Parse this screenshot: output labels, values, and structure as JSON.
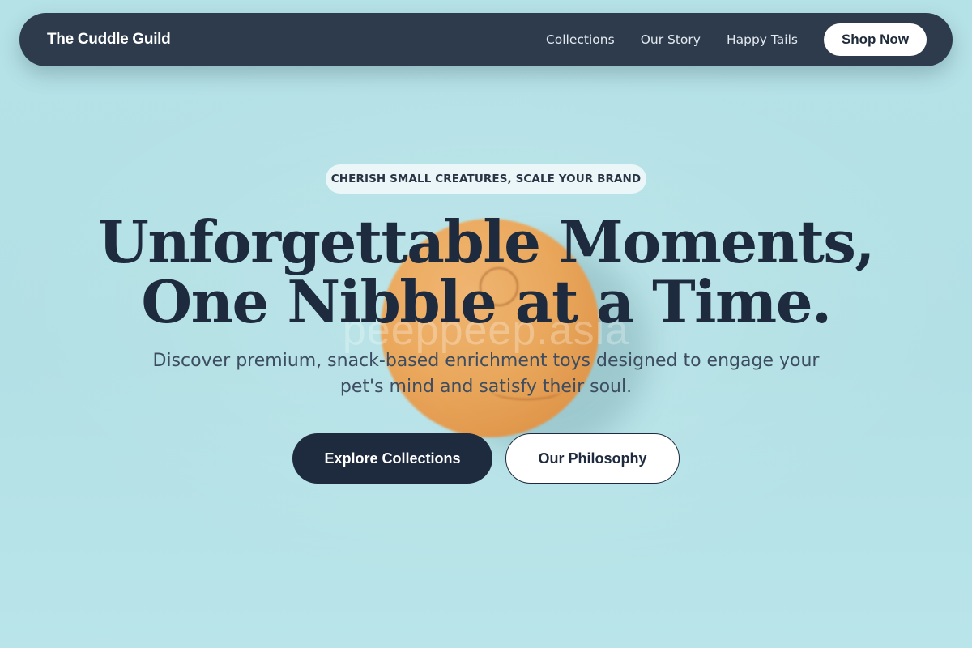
{
  "nav": {
    "brand": "The Cuddle Guild",
    "links": [
      "Collections",
      "Our Story",
      "Happy Tails"
    ],
    "cta": "Shop Now"
  },
  "hero": {
    "tagline": "CHERISH SMALL CREATURES, SCALE YOUR BRAND",
    "headline_line1": "Unforgettable Moments,",
    "headline_line2": "One Nibble at a Time.",
    "subtext_line1": "Discover premium, snack-based enrichment toys designed to engage your",
    "subtext_line2": "pet's mind and satisfy their soul.",
    "primary_button": "Explore Collections",
    "secondary_button": "Our Philosophy",
    "watermark": "peeppeep.asia"
  },
  "colors": {
    "background": "#b3e1e6",
    "navbar": "#2d3b4d",
    "primary": "#1e2a3d",
    "accent_ball": "#f0a553"
  }
}
